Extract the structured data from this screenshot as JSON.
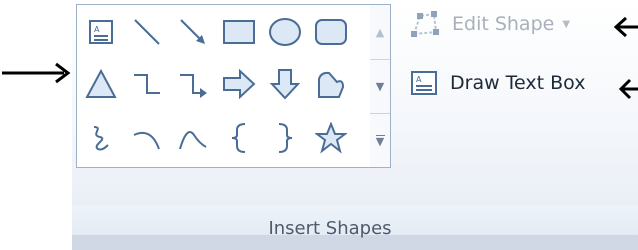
{
  "gallery": {
    "shapes": [
      "text-box-shape",
      "line-shape",
      "arrow-line-shape",
      "rectangle-shape",
      "oval-shape",
      "rounded-rectangle-shape",
      "triangle-shape",
      "elbow-connector-shape",
      "elbow-arrow-connector-shape",
      "right-arrow-shape",
      "down-arrow-shape",
      "freeform-shape",
      "scribble-shape",
      "arc-shape",
      "curve-shape",
      "left-brace-shape",
      "right-brace-shape",
      "star-shape"
    ]
  },
  "scrollbar": {
    "up_icon": "▲",
    "down_icon": "▼",
    "more_icon": "▼"
  },
  "commands": {
    "edit_shape": {
      "label": "Edit Shape",
      "caret": "▼",
      "enabled": false
    },
    "draw_text_box": {
      "label": "Draw Text Box"
    }
  },
  "group": {
    "label": "Insert Shapes"
  },
  "colors": {
    "shape_stroke": "#4a6d96",
    "shape_fill": "#dce8f6",
    "disabled_text": "#a9b0ba",
    "arrow": "#000000"
  }
}
